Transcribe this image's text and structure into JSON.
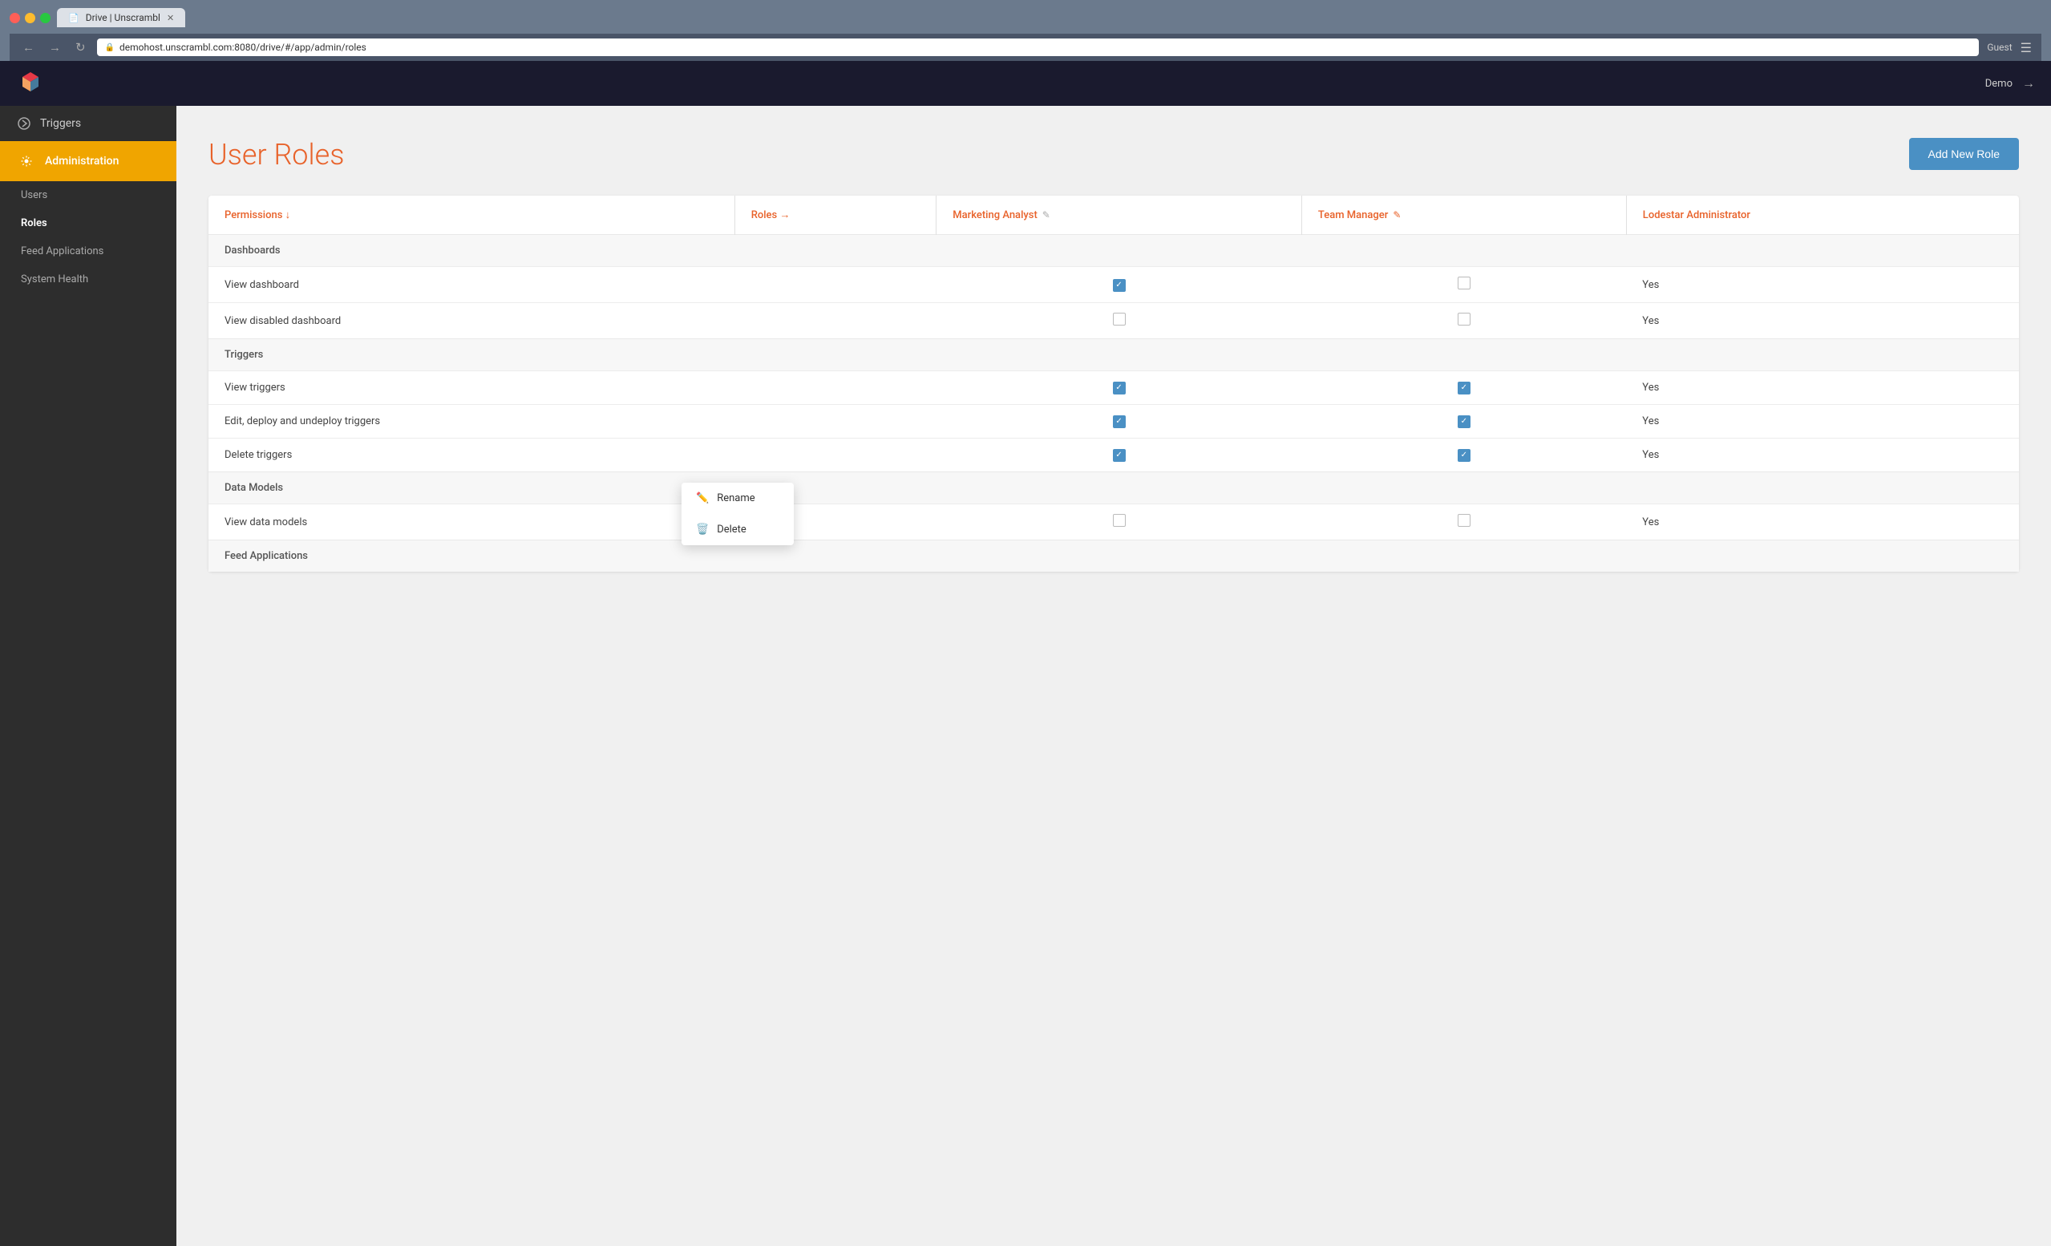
{
  "browser": {
    "url": "demohost.unscrambl.com:8080/drive/#/app/admin/roles",
    "tab_title": "Drive | Unscrambl",
    "guest_label": "Guest"
  },
  "topbar": {
    "user_label": "Demo",
    "logout_icon": "→"
  },
  "sidebar": {
    "triggers_label": "Triggers",
    "administration_label": "Administration",
    "sub_items": [
      {
        "label": "Users",
        "active": false
      },
      {
        "label": "Roles",
        "active": true
      },
      {
        "label": "Feed Applications",
        "active": false
      },
      {
        "label": "System Health",
        "active": false
      }
    ]
  },
  "main": {
    "page_title": "User Roles",
    "add_button_label": "Add New Role",
    "table": {
      "col_permissions": "Permissions ↓",
      "col_roles": "Roles →",
      "col1": "Marketing Analyst",
      "col2": "Team Manager",
      "col3": "Lodestar Administrator",
      "sections": [
        {
          "name": "Dashboards",
          "rows": [
            {
              "label": "View dashboard",
              "col1": true,
              "col1_checked": true,
              "col2": false,
              "col2_checked": false,
              "col3": "Yes"
            },
            {
              "label": "View disabled dashboard",
              "col1": false,
              "col1_checked": false,
              "col2": false,
              "col2_checked": false,
              "col3": "Yes"
            }
          ]
        },
        {
          "name": "Triggers",
          "rows": [
            {
              "label": "View triggers",
              "col1": true,
              "col1_checked": true,
              "col2": true,
              "col2_checked": true,
              "col3": "Yes"
            },
            {
              "label": "Edit, deploy and undeploy triggers",
              "col1": true,
              "col1_checked": true,
              "col2": true,
              "col2_checked": true,
              "col3": "Yes"
            },
            {
              "label": "Delete triggers",
              "col1": true,
              "col1_checked": true,
              "col2": true,
              "col2_checked": true,
              "col3": "Yes"
            }
          ]
        },
        {
          "name": "Data Models",
          "rows": [
            {
              "label": "View data models",
              "col1": false,
              "col1_checked": false,
              "col2": false,
              "col2_checked": false,
              "col3": "Yes"
            }
          ]
        },
        {
          "name": "Feed Applications",
          "rows": []
        }
      ]
    },
    "context_menu": {
      "items": [
        {
          "label": "Rename",
          "icon": "✏"
        },
        {
          "label": "Delete",
          "icon": "🗑"
        }
      ]
    }
  }
}
